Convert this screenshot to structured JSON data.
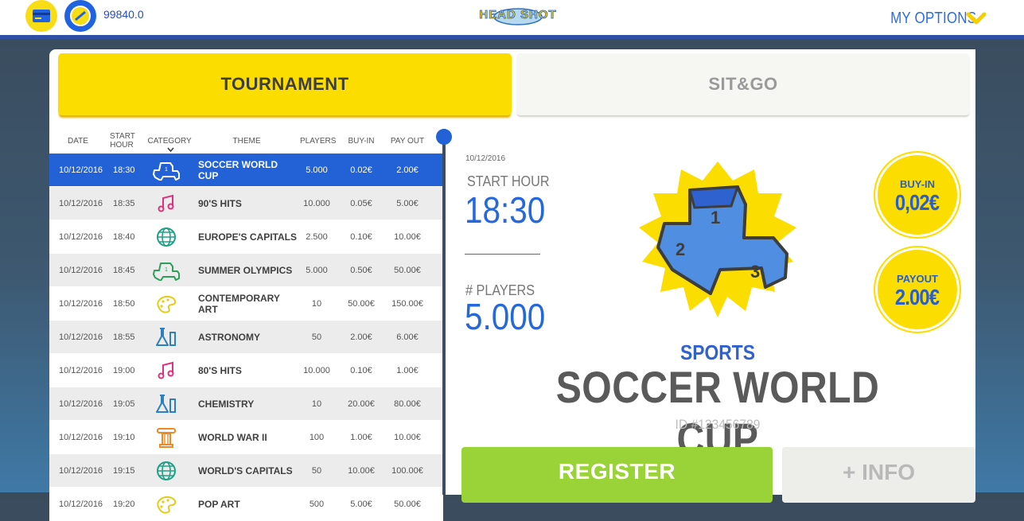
{
  "header": {
    "balance": "99840.0",
    "logo_text": "HEAD SHOT",
    "options_label": "MY OPTIONS",
    "icons": [
      "credit-card-icon",
      "coin-icon",
      "chevron-down-icon"
    ]
  },
  "tabs": [
    {
      "label": "TOURNAMENT",
      "active": true
    },
    {
      "label": "SIT&GO",
      "active": false
    }
  ],
  "table": {
    "headers": {
      "date": "DATE",
      "start_hour": "START HOUR",
      "category": "CATEGORY",
      "theme": "THEME",
      "players": "PLAYERS",
      "buy_in": "BUY-IN",
      "pay_out": "PAY OUT"
    },
    "rows": [
      {
        "date": "10/12/2016",
        "hour": "18:30",
        "icon": "podium-icon",
        "theme": "SOCCER WORLD CUP",
        "players": "5.000",
        "buy_in": "0.02€",
        "pay_out": "2.00€",
        "selected": true
      },
      {
        "date": "10/12/2016",
        "hour": "18:35",
        "icon": "music-note-icon",
        "theme": "90'S HITS",
        "players": "10.000",
        "buy_in": "0.05€",
        "pay_out": "5.00€"
      },
      {
        "date": "10/12/2016",
        "hour": "18:40",
        "icon": "globe-icon",
        "theme": "EUROPE'S CAPITALS",
        "players": "2.500",
        "buy_in": "0.10€",
        "pay_out": "10.00€"
      },
      {
        "date": "10/12/2016",
        "hour": "18:45",
        "icon": "podium-icon",
        "theme": "SUMMER OLYMPICS",
        "players": "5.000",
        "buy_in": "0.50€",
        "pay_out": "50.00€"
      },
      {
        "date": "10/12/2016",
        "hour": "18:50",
        "icon": "palette-icon",
        "theme": "CONTEMPORARY ART",
        "players": "10",
        "buy_in": "50.00€",
        "pay_out": "150.00€"
      },
      {
        "date": "10/12/2016",
        "hour": "18:55",
        "icon": "flask-icon",
        "theme": "ASTRONOMY",
        "players": "50",
        "buy_in": "2.00€",
        "pay_out": "6.00€"
      },
      {
        "date": "10/12/2016",
        "hour": "19:00",
        "icon": "music-note-icon",
        "theme": "80'S HITS",
        "players": "10.000",
        "buy_in": "0.10€",
        "pay_out": "1.00€"
      },
      {
        "date": "10/12/2016",
        "hour": "19:05",
        "icon": "flask-icon",
        "theme": "CHEMISTRY",
        "players": "10",
        "buy_in": "20.00€",
        "pay_out": "80.00€"
      },
      {
        "date": "10/12/2016",
        "hour": "19:10",
        "icon": "column-icon",
        "theme": "WORLD WAR II",
        "players": "100",
        "buy_in": "1.00€",
        "pay_out": "10.00€"
      },
      {
        "date": "10/12/2016",
        "hour": "19:15",
        "icon": "globe-icon",
        "theme": "WORLD'S CAPITALS",
        "players": "50",
        "buy_in": "10.00€",
        "pay_out": "100.00€"
      },
      {
        "date": "10/12/2016",
        "hour": "19:20",
        "icon": "palette-icon",
        "theme": "POP ART",
        "players": "500",
        "buy_in": "5.00€",
        "pay_out": "50.00€"
      }
    ]
  },
  "detail": {
    "date": "10/12/2016",
    "start_hour_label": "START HOUR",
    "start_hour": "18:30",
    "players_label": "# PLAYERS",
    "players": "5.000",
    "buy_in_label": "BUY-IN",
    "buy_in": "0,02€",
    "payout_label": "PAYOUT",
    "payout": "2.00€",
    "category": "SPORTS",
    "theme": "SOCCER WORLD CUP",
    "id": "ID #123456789",
    "register_label": "REGISTER",
    "info_label": "+ INFO"
  },
  "colors": {
    "accent_yellow": "#fbdd00",
    "accent_blue": "#2262d6",
    "register_green": "#9ad337"
  }
}
